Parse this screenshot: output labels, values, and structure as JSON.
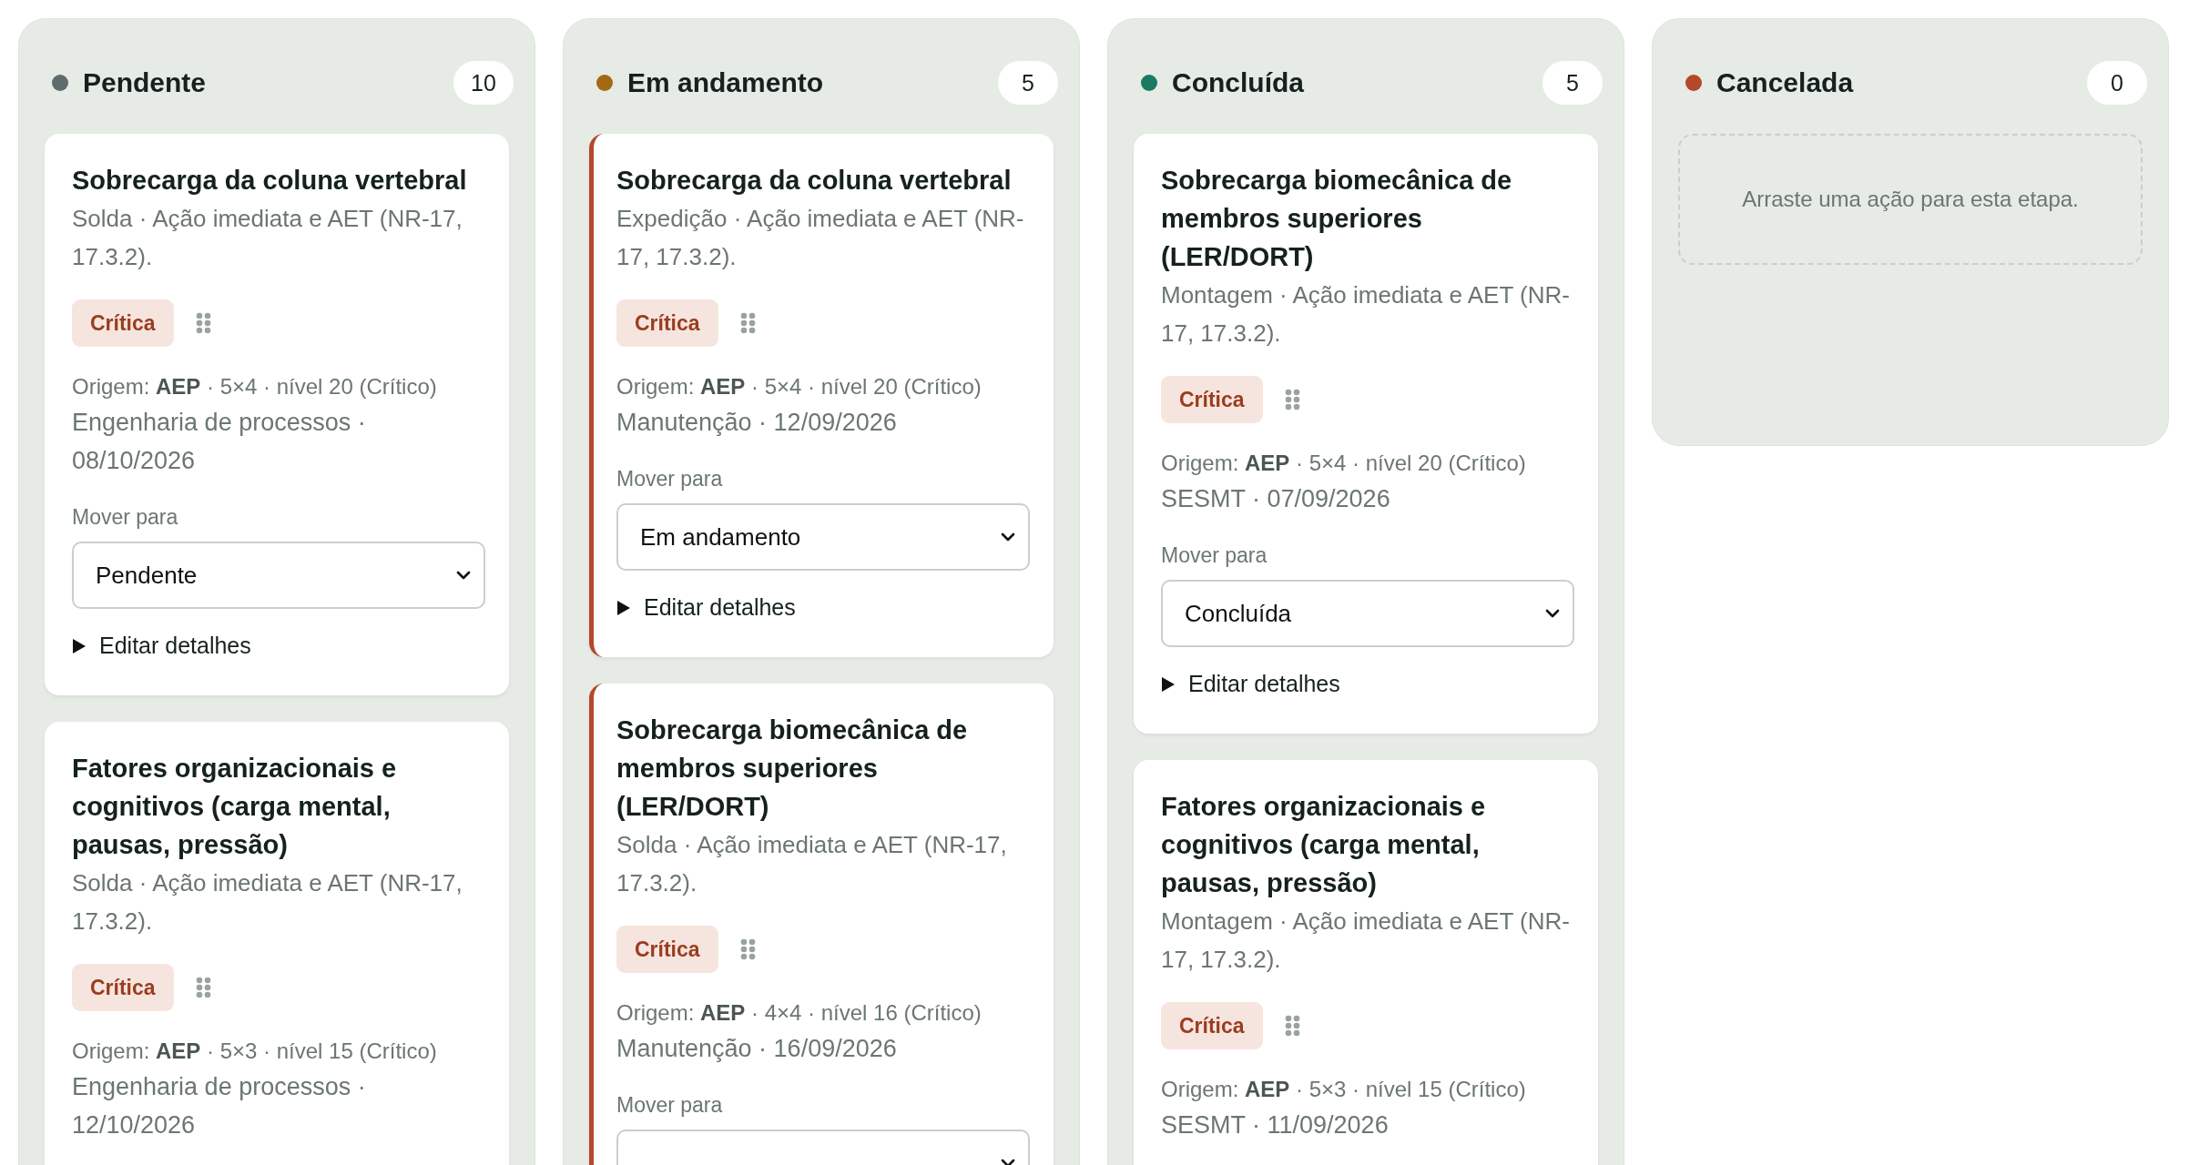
{
  "columns": [
    {
      "title": "Pendente",
      "color": "#5f6b6d",
      "count": "10",
      "cards": [
        {
          "title": "Sobrecarga da coluna vertebral",
          "subtitle": "Solda · Ação imediata e AET (NR-17, 17.3.2).",
          "priority": "Crítica",
          "origin": "Origem: **AEP** · 5×4 · nível 20 (Crítico)",
          "meta": "Engenharia de processos · 08/10/2026",
          "flagged": false,
          "move_label": "Mover para",
          "move_value": "Pendente",
          "details_label": "Editar detalhes",
          "expanded": false
        },
        {
          "title": "Fatores organizacionais e cognitivos (carga mental, pausas, pressão)",
          "subtitle": "Solda · Ação imediata e AET (NR-17, 17.3.2).",
          "priority": "Crítica",
          "origin": "Origem: **AEP** · 5×3 · nível 15 (Crítico)",
          "meta": "Engenharia de processos · 12/10/2026",
          "flagged": false
        }
      ]
    },
    {
      "title": "Em andamento",
      "color": "#a36a12",
      "count": "5",
      "cards": [
        {
          "title": "Sobrecarga da coluna vertebral",
          "subtitle": "Expedição · Ação imediata e AET (NR-17, 17.3.2).",
          "priority": "Crítica",
          "origin": "Origem: **AEP** · 5×4 · nível 20 (Crítico)",
          "meta": "Manutenção · 12/09/2026",
          "flagged": true,
          "move_label": "Mover para",
          "move_value": "Em andamento",
          "details_label": "Editar detalhes",
          "expanded": false
        },
        {
          "title": "Sobrecarga biomecânica de membros superiores (LER/DORT)",
          "subtitle": "Solda · Ação imediata e AET (NR-17, 17.3.2).",
          "priority": "Crítica",
          "origin": "Origem: **AEP** · 4×4 · nível 16 (Crítico)",
          "meta": "Manutenção · 16/09/2026",
          "flagged": true,
          "move_label": "Mover para"
        }
      ]
    },
    {
      "title": "Concluída",
      "color": "#1b7a62",
      "count": "5",
      "cards": [
        {
          "title": "Sobrecarga biomecânica de membros superiores (LER/DORT)",
          "subtitle": "Montagem · Ação imediata e AET (NR-17, 17.3.2).",
          "priority": "Crítica",
          "origin": "Origem: **AEP** · 5×4 · nível 20 (Crítico)",
          "meta": "SESMT · 07/09/2026",
          "flagged": false,
          "move_label": "Mover para",
          "move_value": "Concluída",
          "details_label": "Editar detalhes",
          "expanded": false
        },
        {
          "title": "Fatores organizacionais e cognitivos (carga mental, pausas, pressão)",
          "subtitle": "Montagem · Ação imediata e AET (NR-17, 17.3.2).",
          "priority": "Crítica",
          "origin": "Origem: **AEP** · 5×3 · nível 15 (Crítico)",
          "meta": "SESMT · 11/09/2026",
          "flagged": false
        }
      ]
    },
    {
      "title": "Cancelada",
      "color": "#b5482a",
      "count": "0",
      "empty_text": "Arraste uma ação para esta etapa."
    }
  ]
}
